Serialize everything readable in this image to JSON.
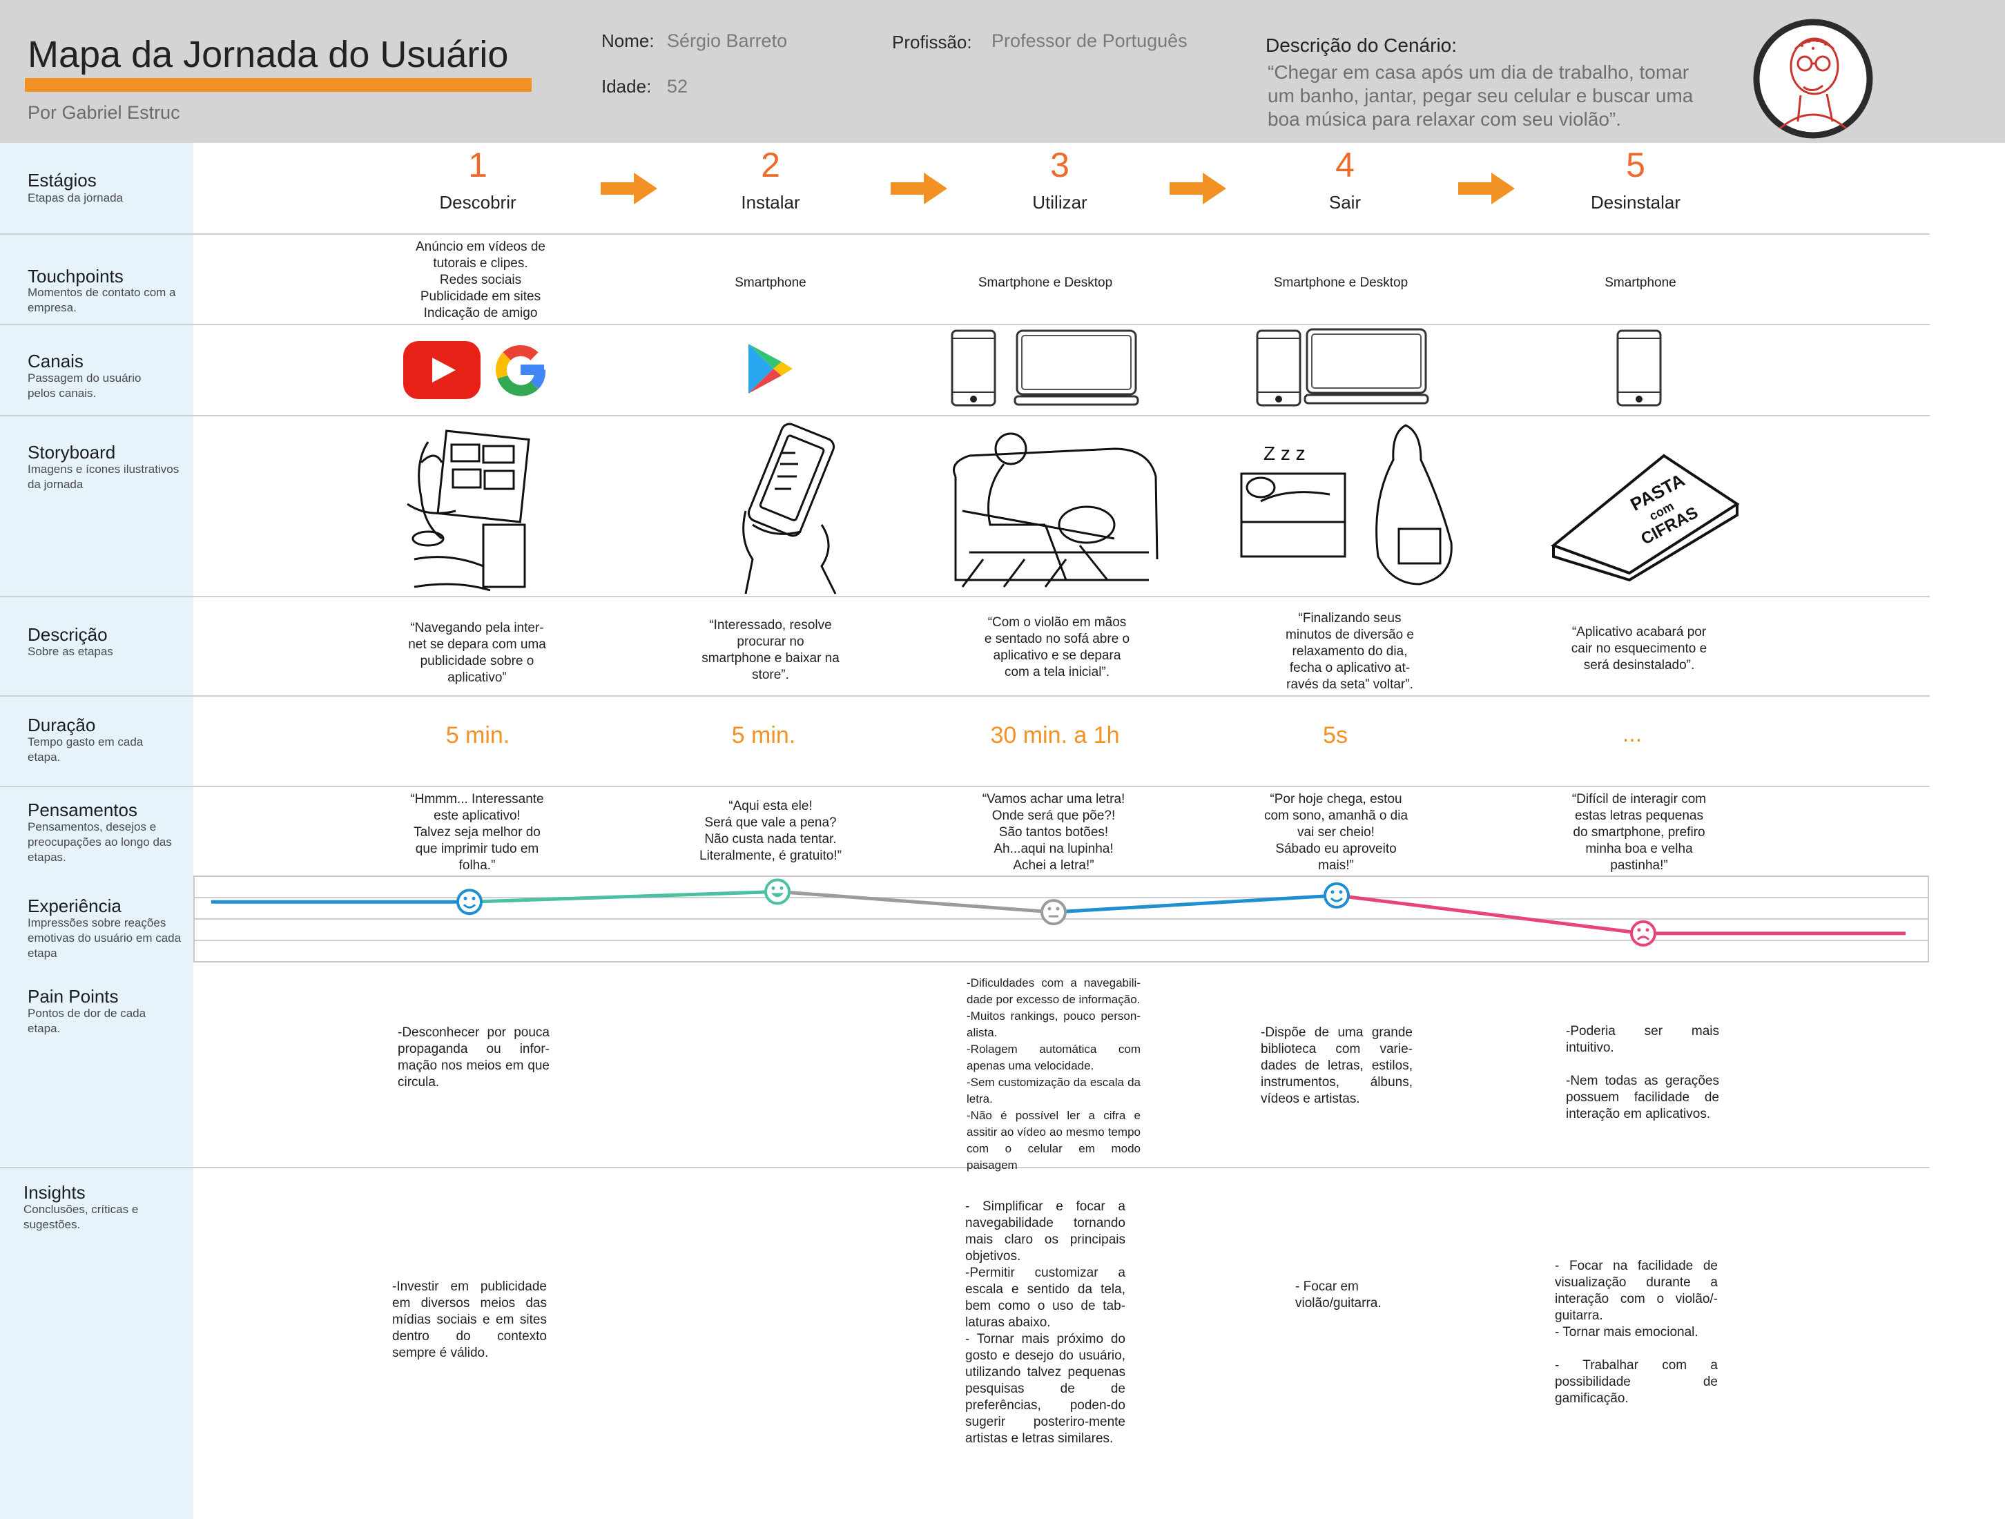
{
  "header": {
    "title": "Mapa da Jornada do Usuário",
    "author": "Por Gabriel Estruc",
    "name_label": "Nome:",
    "name_value": "Sérgio Barreto",
    "age_label": "Idade:",
    "age_value": "52",
    "profession_label": "Profissão:",
    "profession_value": "Professor de Português",
    "scenario_label": "Descrição do Cenário:",
    "scenario_text": "“Chegar em casa após um dia de trabalho, tomar um banho, jantar, pegar seu celular e buscar uma boa música para relaxar com seu  violão”."
  },
  "rows": {
    "estagios": {
      "label": "Estágios",
      "sub": "Etapas da jornada"
    },
    "touchpoints": {
      "label": "Touchpoints",
      "sub": "Momentos de contato com a empresa."
    },
    "canais": {
      "label": "Canais",
      "sub": "Passagem do usuário pelos canais."
    },
    "storyboard": {
      "label": "Storyboard",
      "sub": "Imagens e ícones ilustrativos da jornada"
    },
    "descricao": {
      "label": "Descrição",
      "sub": "Sobre as etapas"
    },
    "duracao": {
      "label": "Duração",
      "sub": "Tempo gasto em cada etapa."
    },
    "pensamentos": {
      "label": "Pensamentos",
      "sub": "Pensamentos, desejos e preocupações ao longo das etapas."
    },
    "experiencia": {
      "label": "Experiência",
      "sub": "Impressões sobre reações emotivas do usuário em cada etapa"
    },
    "painpoints": {
      "label": "Pain Points",
      "sub": "Pontos de dor de cada etapa."
    },
    "insights": {
      "label": "Insights",
      "sub": "Conclusões, críticas e sugestões."
    }
  },
  "stages": [
    {
      "number": "1",
      "name": "Descobrir",
      "touchpoint": "Anúncio em vídeos de\ntutorais e clipes.\nRedes sociais\nPublicidade em sites\nIndicação de amigo",
      "description": "“Navegando pela inter-\nnet se depara com uma\npublicidade sobre o\naplicativo”",
      "duration": "5 min.",
      "thought": "“Hmmm... Interessante\neste aplicativo!\nTalvez seja melhor do\nque imprimir tudo em\nfolha.”",
      "pain": "-Desconhecer por pouca propaganda ou infor-mação nos meios em que circula.",
      "insight": "-Investir em publicidade em diversos meios das mídias sociais e em sites dentro do contexto sempre é válido."
    },
    {
      "number": "2",
      "name": "Instalar",
      "touchpoint": "Smartphone",
      "description": "“Interessado, resolve\nprocurar no\nsmartphone e baixar na\nstore”.",
      "duration": "5 min.",
      "thought": "“Aqui esta ele!\nSerá que vale a pena?\nNão custa nada tentar.\nLiteralmente, é gratuito!”",
      "pain": "",
      "insight": ""
    },
    {
      "number": "3",
      "name": "Utilizar",
      "touchpoint": "Smartphone e Desktop",
      "description": "“Com o violão em mãos\ne sentado no sofá abre o\naplicativo e se depara\ncom a tela inicial”.",
      "duration": "30 min. a 1h",
      "thought": "“Vamos achar uma letra!\nOnde será que põe?!\nSão tantos botões!\nAh...aqui na lupinha!\nAchei a letra!”",
      "pain": "-Dificuldades com a navegabili-dade por excesso de informação.\n-Muitos rankings, pouco person-alista.\n-Rolagem automática com apenas uma velocidade.\n-Sem customização da escala da letra.\n-Não é possível ler a cifra e assitir ao vídeo ao mesmo tempo com o celular em modo paisagem",
      "insight": " - Simplificar e focar a navegabilidade tornando mais claro os principais objetivos.\n -Permitir customizar a escala e sentido da tela, bem como o uso de tab-laturas abaixo.\n- Tornar mais próximo do gosto e desejo do usuário, utilizando talvez pequenas pesquisas de de preferências, poden-do sugerir posteriro-mente artistas e letras similares."
    },
    {
      "number": "4",
      "name": "Sair",
      "touchpoint": "Smartphone e Desktop",
      "description": "“Finalizando seus\nminutos de diversão e\nrelaxamento do dia,\nfecha o aplicativo at-\nravés da seta” voltar”.",
      "duration": "5s",
      "thought": "“Por hoje chega, estou\ncom sono, amanhã o dia\nvai ser cheio!\nSábado eu aproveito\nmais!”",
      "pain": "-Dispõe de uma grande biblioteca com varie-dades de letras, estilos, instrumentos, álbuns, vídeos e artistas.",
      "insight": "- Focar em\nviolão/guitarra."
    },
    {
      "number": "5",
      "name": "Desinstalar",
      "touchpoint": "Smartphone",
      "description": "“Aplicativo acabará por\ncair no esquecimento e\nserá desinstalado”.",
      "duration": "...",
      "thought": "“Difícil de interagir com\nestas letras pequenas\ndo smartphone, prefiro\nminha boa e velha\npastinha!”",
      "pain": "-Poderia ser mais intuitivo.\n\n-Nem todas as gerações possuem facilidade de interação em aplicativos.",
      "insight": " - Focar na facilidade de visualização durante a interação com o violão/-guitarra.\n- Tornar mais emocional.\n\n- Trabalhar com a possibilidade de gamificação."
    }
  ],
  "storyboard_text": {
    "pasta_1": "PASTA",
    "pasta_2": "com",
    "pasta_3": "CIFRAS",
    "zzz": "Z z z"
  },
  "emotion": {
    "levels": [
      0.45,
      0.72,
      0.18,
      0.62,
      -0.38
    ],
    "faces": [
      "happy",
      "very-happy",
      "neutral",
      "happy",
      "sad"
    ],
    "colors": {
      "blue": "#1e8fcf",
      "teal": "#4cc0a2",
      "gray": "#9b9b9b",
      "pink": "#e84577"
    }
  },
  "colors": {
    "orange": "#f39224",
    "stage_number": "#ee6a2b",
    "youtube": "#e62117"
  }
}
